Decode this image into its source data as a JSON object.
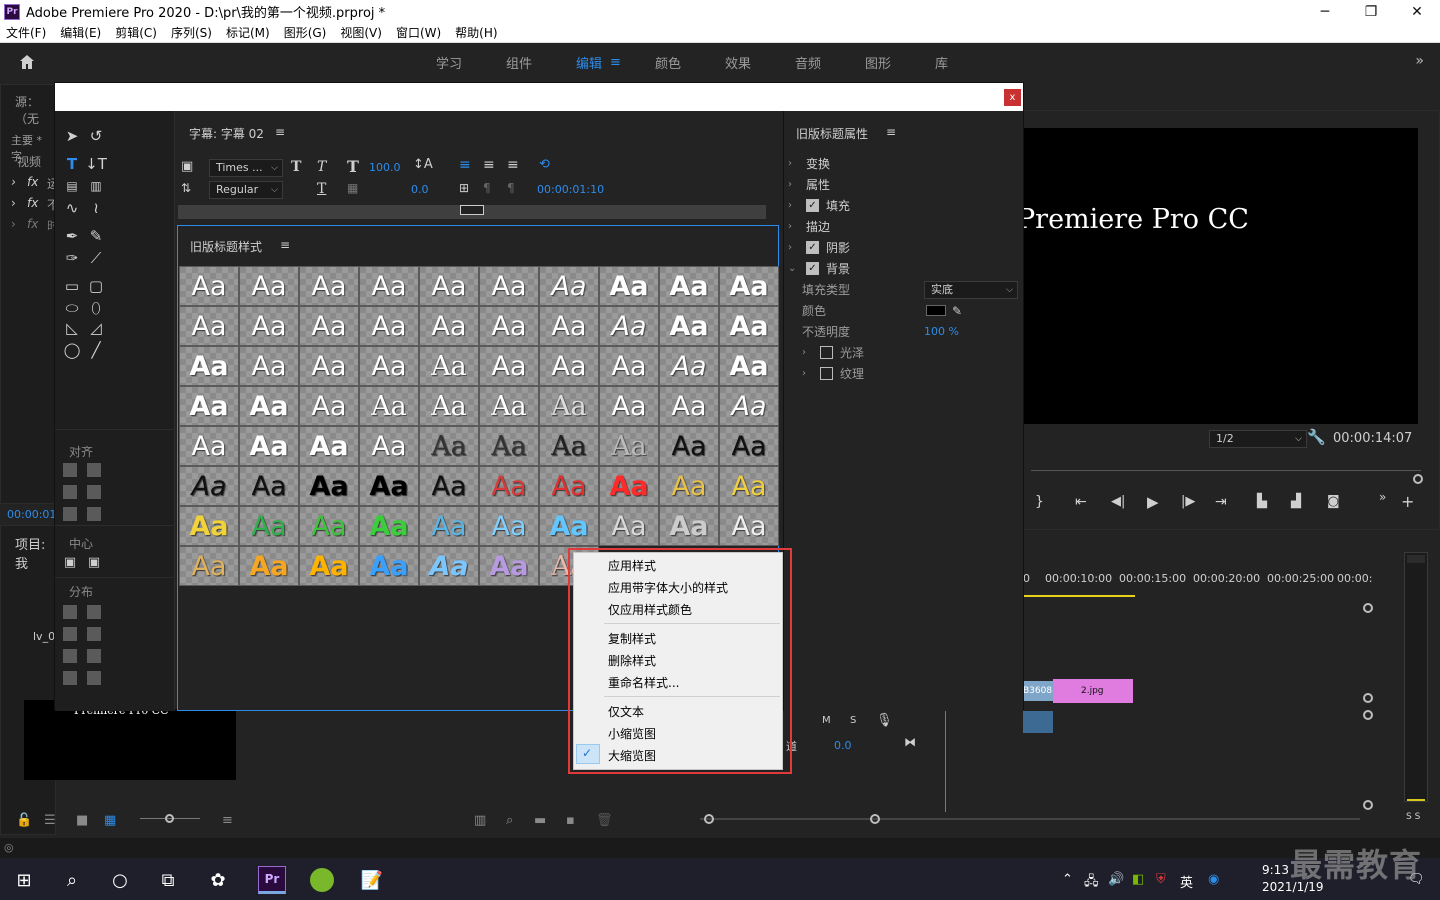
{
  "window": {
    "app_icon": "Pr",
    "title": "Adobe Premiere Pro 2020 - D:\\pr\\我的第一个视频.prproj *",
    "minimize": "─",
    "maximize": "❐",
    "close": "✕"
  },
  "menubar": [
    "文件(F)",
    "编辑(E)",
    "剪辑(C)",
    "序列(S)",
    "标记(M)",
    "图形(G)",
    "视图(V)",
    "窗口(W)",
    "帮助(H)"
  ],
  "workspace_tabs": [
    {
      "label": "学习",
      "active": false
    },
    {
      "label": "组件",
      "active": false
    },
    {
      "label": "编辑",
      "active": true
    },
    {
      "label": "颜色",
      "active": false
    },
    {
      "label": "效果",
      "active": false
    },
    {
      "label": "音频",
      "active": false
    },
    {
      "label": "图形",
      "active": false
    },
    {
      "label": "库",
      "active": false
    }
  ],
  "workspace_menu_icon": "≡",
  "workspace_more": "»",
  "source_panel": {
    "title": "源：（无",
    "tab": "主要 * 字",
    "video_label": "视频",
    "fx1": "fx",
    "fx1_text": "运",
    "fx2": "fx",
    "fx2_text": "不",
    "fx3": "fx",
    "fx3_text": "时",
    "timecode": "00:00:01:"
  },
  "project_panel": {
    "title": "项目: 我",
    "item": "lv_0",
    "thumb_text": "Premiere Pro CC"
  },
  "dialog": {
    "close": "x",
    "subtitle_panel_title": "字幕: 字幕 02",
    "panel_menu": "≡",
    "font_family": "Times ...",
    "font_style": "Regular",
    "font_size": "100.0",
    "tracking": "0.0",
    "timecode": "00:00:01:10",
    "styles_panel_title": "旧版标题样式",
    "props_title": "旧版标题属性",
    "align_title": "对齐",
    "center_title": "中心",
    "distribute_title": "分布"
  },
  "style_swatches": [
    {
      "label": "Aa",
      "color": "#ffffff",
      "font": "sans",
      "weight": "normal",
      "italic": false
    },
    {
      "label": "Aa",
      "color": "#ffffff",
      "font": "sans",
      "weight": "normal",
      "italic": false
    },
    {
      "label": "Aa",
      "color": "#ffffff",
      "font": "sans",
      "weight": "normal",
      "italic": false
    },
    {
      "label": "Aa",
      "color": "#ffffff",
      "font": "sans",
      "weight": "normal",
      "italic": false
    },
    {
      "label": "Aa",
      "color": "#ffffff",
      "font": "sans",
      "weight": "normal",
      "italic": false
    },
    {
      "label": "Aa",
      "color": "#ffffff",
      "font": "sans",
      "weight": "normal",
      "italic": false
    },
    {
      "label": "Aa",
      "color": "#ffffff",
      "font": "sans",
      "weight": "normal",
      "italic": true
    },
    {
      "label": "Aa",
      "color": "#ffffff",
      "font": "sans",
      "weight": "bold",
      "italic": false
    },
    {
      "label": "Aa",
      "color": "#ffffff",
      "font": "sans",
      "weight": "bold",
      "italic": false
    },
    {
      "label": "Aa",
      "color": "#ffffff",
      "font": "sans",
      "weight": "bold",
      "italic": false
    },
    {
      "label": "Aa",
      "color": "#ffffff",
      "font": "sans",
      "weight": "normal",
      "italic": false
    },
    {
      "label": "Aa",
      "color": "#ffffff",
      "font": "sans",
      "weight": "normal",
      "italic": false
    },
    {
      "label": "Aa",
      "color": "#ffffff",
      "font": "sans",
      "weight": "normal",
      "italic": false
    },
    {
      "label": "Aa",
      "color": "#ffffff",
      "font": "sans",
      "weight": "normal",
      "italic": false
    },
    {
      "label": "Aa",
      "color": "#ffffff",
      "font": "sans",
      "weight": "normal",
      "italic": false
    },
    {
      "label": "Aa",
      "color": "#ffffff",
      "font": "sans",
      "weight": "normal",
      "italic": false
    },
    {
      "label": "Aa",
      "color": "#ffffff",
      "font": "sans",
      "weight": "normal",
      "italic": false
    },
    {
      "label": "Aa",
      "color": "#ffffff",
      "font": "sans",
      "weight": "normal",
      "italic": true
    },
    {
      "label": "Aa",
      "color": "#ffffff",
      "font": "sans",
      "weight": "bold",
      "italic": false
    },
    {
      "label": "Aa",
      "color": "#ffffff",
      "font": "sans",
      "weight": "bold",
      "italic": false
    },
    {
      "label": "Aa",
      "color": "#ffffff",
      "font": "sans",
      "weight": "bold",
      "italic": false
    },
    {
      "label": "Aa",
      "color": "#ffffff",
      "font": "sans",
      "weight": "normal",
      "italic": false
    },
    {
      "label": "Aa",
      "color": "#ffffff",
      "font": "sans",
      "weight": "normal",
      "italic": false
    },
    {
      "label": "Aa",
      "color": "#ffffff",
      "font": "sans",
      "weight": "normal",
      "italic": false
    },
    {
      "label": "Aa",
      "color": "#ffffff",
      "font": "serif",
      "weight": "normal",
      "italic": false
    },
    {
      "label": "Aa",
      "color": "#ffffff",
      "font": "sans",
      "weight": "normal",
      "italic": false
    },
    {
      "label": "Aa",
      "color": "#ffffff",
      "font": "sans",
      "weight": "normal",
      "italic": false
    },
    {
      "label": "Aa",
      "color": "#ffffff",
      "font": "sans",
      "weight": "normal",
      "italic": false
    },
    {
      "label": "Aa",
      "color": "#ffffff",
      "font": "sans",
      "weight": "normal",
      "italic": true
    },
    {
      "label": "Aa",
      "color": "#ffffff",
      "font": "sans",
      "weight": "bold",
      "italic": false
    },
    {
      "label": "Aa",
      "color": "#ffffff",
      "font": "sans",
      "weight": "bold",
      "italic": false
    },
    {
      "label": "Aa",
      "color": "#ffffff",
      "font": "sans",
      "weight": "bold",
      "italic": false
    },
    {
      "label": "Aa",
      "color": "#ffffff",
      "font": "sans",
      "weight": "normal",
      "italic": false
    },
    {
      "label": "Aa",
      "color": "#ffffff",
      "font": "serif",
      "weight": "normal",
      "italic": false
    },
    {
      "label": "Aa",
      "color": "#ffffff",
      "font": "serif",
      "weight": "normal",
      "italic": false
    },
    {
      "label": "Aa",
      "color": "#ffffff",
      "font": "serif",
      "weight": "normal",
      "italic": false
    },
    {
      "label": "Aa",
      "color": "#dddddd",
      "font": "serif",
      "weight": "normal",
      "italic": false
    },
    {
      "label": "Aa",
      "color": "#ffffff",
      "font": "sans",
      "weight": "normal",
      "italic": false
    },
    {
      "label": "Aa",
      "color": "#ffffff",
      "font": "sans",
      "weight": "normal",
      "italic": false
    },
    {
      "label": "Aa",
      "color": "#ffffff",
      "font": "sans",
      "weight": "normal",
      "italic": true
    },
    {
      "label": "Aa",
      "color": "#ffffff",
      "font": "sans",
      "weight": "normal",
      "italic": false
    },
    {
      "label": "Aa",
      "color": "#ffffff",
      "font": "sans",
      "weight": "bold",
      "italic": false
    },
    {
      "label": "Aa",
      "color": "#ffffff",
      "font": "sans",
      "weight": "bold",
      "italic": false
    },
    {
      "label": "Aa",
      "color": "#ffffff",
      "font": "sans",
      "weight": "normal",
      "italic": false
    },
    {
      "label": "Aa",
      "color": "#333333",
      "font": "serif",
      "weight": "normal",
      "italic": false
    },
    {
      "label": "Aa",
      "color": "#333333",
      "font": "serif",
      "weight": "normal",
      "italic": false
    },
    {
      "label": "Aa",
      "color": "#222222",
      "font": "serif",
      "weight": "normal",
      "italic": false
    },
    {
      "label": "Aa",
      "color": "#bbbbbb",
      "font": "serif",
      "weight": "normal",
      "italic": false
    },
    {
      "label": "Aa",
      "color": "#111111",
      "font": "sans",
      "weight": "normal",
      "italic": false
    },
    {
      "label": "Aa",
      "color": "#111111",
      "font": "sans",
      "weight": "normal",
      "italic": false
    },
    {
      "label": "Aa",
      "color": "#111111",
      "font": "sans",
      "weight": "normal",
      "italic": true
    },
    {
      "label": "Aa",
      "color": "#111111",
      "font": "sans",
      "weight": "normal",
      "italic": false
    },
    {
      "label": "Aa",
      "color": "#000000",
      "font": "sans",
      "weight": "bold",
      "italic": false
    },
    {
      "label": "Aa",
      "color": "#000000",
      "font": "sans",
      "weight": "bold",
      "italic": false
    },
    {
      "label": "Aa",
      "color": "#111111",
      "font": "sans",
      "weight": "normal",
      "italic": false
    },
    {
      "label": "Aa",
      "color": "#d83a3a",
      "font": "sans",
      "weight": "normal",
      "italic": false
    },
    {
      "label": "Aa",
      "color": "#e03030",
      "font": "sans",
      "weight": "normal",
      "italic": false
    },
    {
      "label": "Aa",
      "color": "#ff2a2a",
      "font": "sans",
      "weight": "bold",
      "italic": false
    },
    {
      "label": "Aa",
      "color": "#e8c24a",
      "font": "sans",
      "weight": "normal",
      "italic": false
    },
    {
      "label": "Aa",
      "color": "#f0d040",
      "font": "sans",
      "weight": "normal",
      "italic": false
    },
    {
      "label": "Aa",
      "color": "#f2d23a",
      "font": "sans",
      "weight": "bold",
      "italic": false
    },
    {
      "label": "Aa",
      "color": "#2fb04a",
      "font": "sans",
      "weight": "normal",
      "italic": false
    },
    {
      "label": "Aa",
      "color": "#3cc43c",
      "font": "sans",
      "weight": "normal",
      "italic": false
    },
    {
      "label": "Aa",
      "color": "#3acf3a",
      "font": "sans",
      "weight": "bold",
      "italic": false
    },
    {
      "label": "Aa",
      "color": "#59b7e8",
      "font": "sans",
      "weight": "normal",
      "italic": false
    },
    {
      "label": "Aa",
      "color": "#7fd0ff",
      "font": "sans",
      "weight": "normal",
      "italic": false
    },
    {
      "label": "Aa",
      "color": "#62c6ff",
      "font": "sans",
      "weight": "bold",
      "italic": false
    },
    {
      "label": "Aa",
      "color": "#d9d9d9",
      "font": "sans",
      "weight": "normal",
      "italic": false
    },
    {
      "label": "Aa",
      "color": "#cccccc",
      "font": "sans",
      "weight": "bold",
      "italic": false
    },
    {
      "label": "Aa",
      "color": "#eeeeee",
      "font": "sans",
      "weight": "normal",
      "italic": false
    },
    {
      "label": "Aa",
      "color": "#e0b25c",
      "font": "sans",
      "weight": "normal",
      "italic": false
    },
    {
      "label": "Aa",
      "color": "#f5a623",
      "font": "sans",
      "weight": "bold",
      "italic": false
    },
    {
      "label": "Aa",
      "color": "#ffb300",
      "font": "sans",
      "weight": "bold",
      "italic": false
    },
    {
      "label": "Aa",
      "color": "#3aa0ff",
      "font": "sans",
      "weight": "bold",
      "italic": false
    },
    {
      "label": "Aa",
      "color": "#7cc6ff",
      "font": "sans",
      "weight": "bold",
      "italic": true
    },
    {
      "label": "Aa",
      "color": "#b79ae0",
      "font": "sans",
      "weight": "bold",
      "italic": false
    },
    {
      "label": "Aa",
      "color": "#e8b7a8",
      "font": "serif",
      "weight": "normal",
      "italic": false
    }
  ],
  "properties": {
    "transform": "变换",
    "attributes": "属性",
    "fill": "填充",
    "stroke": "描边",
    "shadow": "阴影",
    "background": "背景",
    "fill_type_label": "填充类型",
    "fill_type_value": "实底",
    "color_label": "颜色",
    "opacity_label": "不透明度",
    "opacity_value": "100 %",
    "sheen": "光泽",
    "texture": "纹理"
  },
  "context_menu": {
    "items_group1": [
      "应用样式",
      "应用带字体大小的样式",
      "仅应用样式颜色"
    ],
    "items_group2": [
      "复制样式",
      "删除样式",
      "重命名样式..."
    ],
    "items_group3": [
      "仅文本",
      "小缩览图",
      "大缩览图"
    ],
    "checked": "大缩览图",
    "checkmark": "✓"
  },
  "program_monitor": {
    "overlay_text": "Premiere Pro CC",
    "resolution": "1/2",
    "timecode": "00:00:14:07"
  },
  "timeline": {
    "ticks": [
      "0",
      "00:00:10:00",
      "00:00:15:00",
      "00:00:20:00",
      "00:00:25:00",
      "00:00:"
    ],
    "clip1": "B3608.",
    "clip2": "2.jpg",
    "m_label": "M",
    "s_label": "S",
    "vol_value": "0.0",
    "track_label": "道"
  },
  "meter": {
    "s_label": "S S"
  },
  "taskbar": {
    "time": "9:13",
    "date": "2021/1/19",
    "lang": "英",
    "watermark": "最需教育"
  },
  "colors": {
    "accent_blue": "#2d8ceb",
    "highlight_red": "#e03a3a",
    "panel_bg": "#232323"
  }
}
